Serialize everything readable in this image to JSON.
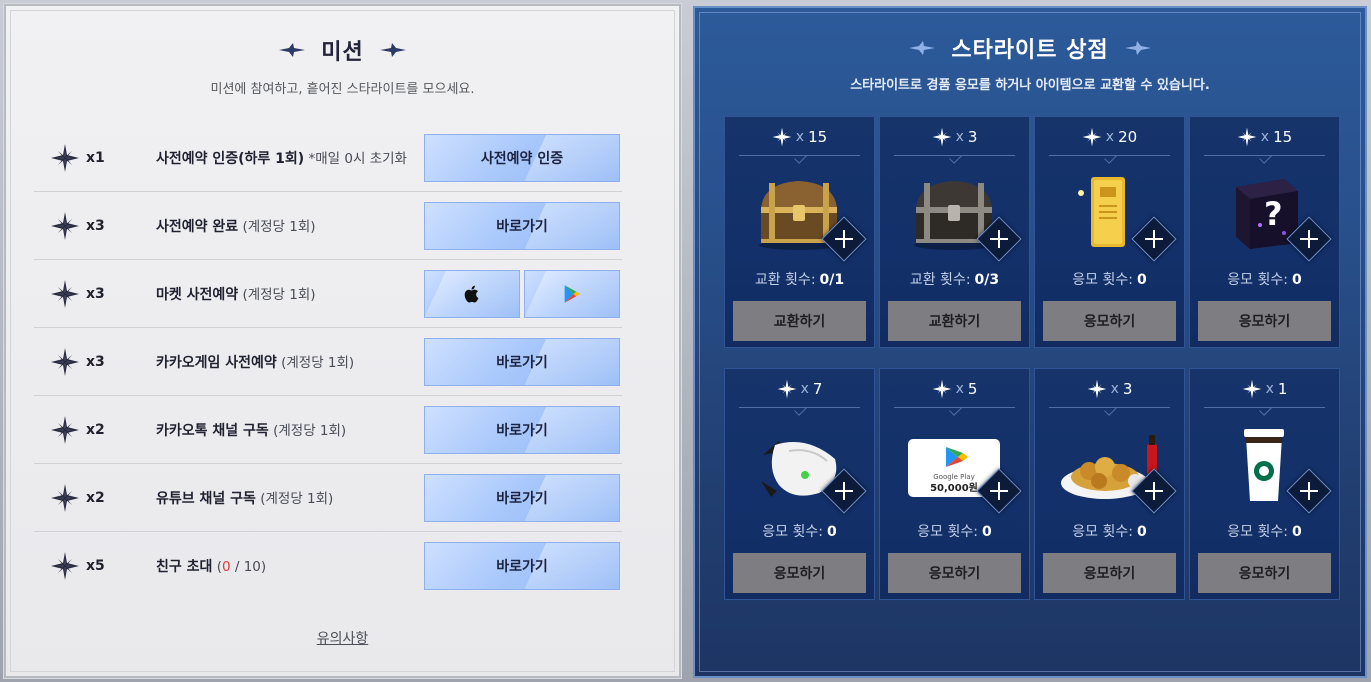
{
  "mission": {
    "title": "미션",
    "subtitle": "미션에 참여하고, 흩어진 스타라이트를 모으세요.",
    "rows": [
      {
        "mult": "x1",
        "main": "사전예약 인증(하루 1회)",
        "sub": " *매일 0시 초기화",
        "button": "사전예약 인증"
      },
      {
        "mult": "x3",
        "main": "사전예약 완료",
        "sub": " (계정당 1회)",
        "button": "바로가기"
      },
      {
        "mult": "x3",
        "main": "마켓 사전예약",
        "sub": " (계정당 1회)",
        "button_left_icon": "apple-icon",
        "button_right_icon": "google-play-icon"
      },
      {
        "mult": "x3",
        "main": "카카오게임 사전예약",
        "sub": " (계정당 1회)",
        "button": "바로가기"
      },
      {
        "mult": "x2",
        "main": "카카오톡 채널 구독",
        "sub": " (계정당 1회)",
        "button": "바로가기"
      },
      {
        "mult": "x2",
        "main": "유튜브 채널 구독",
        "sub": " (계정당 1회)",
        "button": "바로가기"
      },
      {
        "mult": "x5",
        "main": "친구 초대",
        "sub_pre": " (",
        "count": "0",
        "sub_post": " / 10)",
        "button": "바로가기"
      }
    ],
    "notice": "유의사항"
  },
  "shop": {
    "title": "스타라이트 상점",
    "subtitle": "스타라이트로 경품 응모를 하거나 아이템으로 교환할 수 있습니다.",
    "cards": [
      {
        "x": "x",
        "cost": "15",
        "image": "gold-treasure-chest",
        "count_label": "교환 횟수:",
        "count": "0/1",
        "button": "교환하기"
      },
      {
        "x": "x",
        "cost": "3",
        "image": "dark-treasure-chest",
        "count_label": "교환 횟수:",
        "count": "0/3",
        "button": "교환하기"
      },
      {
        "x": "x",
        "cost": "20",
        "image": "gold-bar",
        "count_label": "응모 횟수:",
        "count": "0",
        "button": "응모하기"
      },
      {
        "x": "x",
        "cost": "15",
        "image": "mystery-box",
        "count_label": "응모 횟수:",
        "count": "0",
        "button": "응모하기"
      },
      {
        "x": "x",
        "cost": "7",
        "image": "gaming-mouse",
        "count_label": "응모 횟수:",
        "count": "0",
        "button": "응모하기"
      },
      {
        "x": "x",
        "cost": "5",
        "image": "google-play-gift-card",
        "card_text_1": "Google Play",
        "card_text_2": "50,000원",
        "count_label": "응모 횟수:",
        "count": "0",
        "button": "응모하기"
      },
      {
        "x": "x",
        "cost": "3",
        "image": "fried-chicken",
        "count_label": "응모 횟수:",
        "count": "0",
        "button": "응모하기"
      },
      {
        "x": "x",
        "cost": "1",
        "image": "starbucks-coffee",
        "count_label": "응모 횟수:",
        "count": "0",
        "button": "응모하기"
      }
    ]
  },
  "colors": {
    "accent_button": "#a9c8fb",
    "shop_bg": "#284f8a",
    "card_bg": "#13306a",
    "disabled_button": "#7e7e82",
    "highlight_red": "#e0393b"
  }
}
